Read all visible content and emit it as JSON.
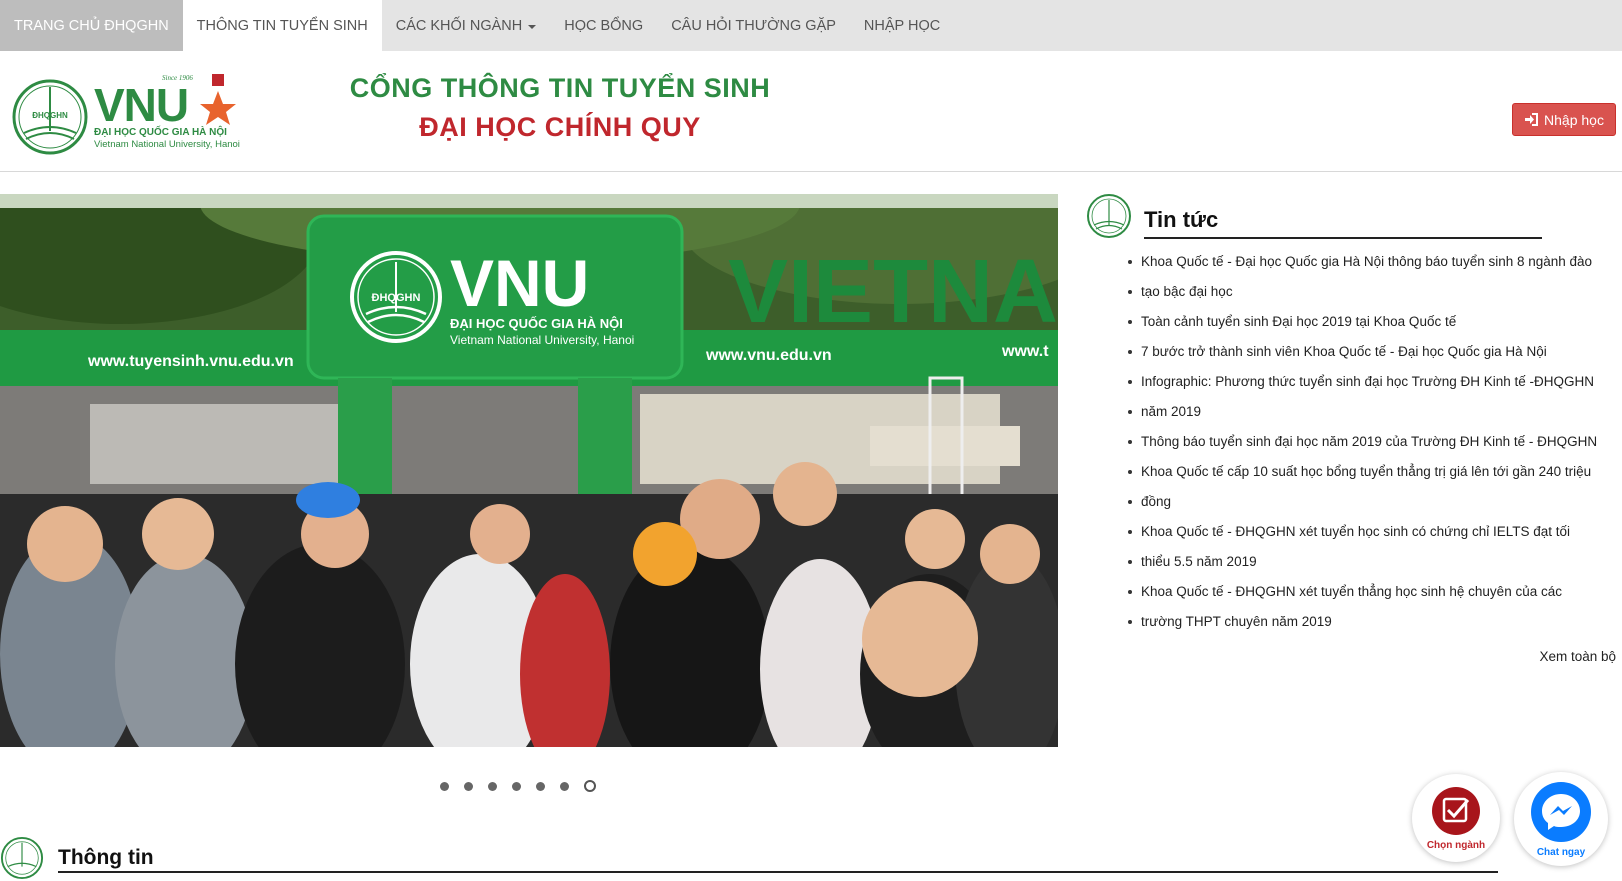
{
  "nav": {
    "home": "TRANG CHỦ ĐHQGHN",
    "admission_info": "THÔNG TIN TUYỂN SINH",
    "fields": "CÁC KHỐI NGÀNH",
    "scholarship": "HỌC BỔNG",
    "faq": "CÂU HỎI THƯỜNG GẶP",
    "enroll": "NHẬP HỌC"
  },
  "header": {
    "logo": {
      "since": "Since 1906",
      "brand": "VNU",
      "seal_text": "ĐHQGHN",
      "name_vi": "ĐẠI HỌC QUỐC GIA HÀ NỘI",
      "name_en": "Vietnam National University, Hanoi"
    },
    "title_line1": "CỔNG THÔNG TIN TUYỂN SINH",
    "title_line2": "ĐẠI HỌC CHÍNH QUY",
    "login_button": "Nhập học"
  },
  "carousel": {
    "sign_brand": "VNU",
    "sign_seal": "ĐHQGHN",
    "sign_name_vi": "ĐẠI HỌC QUỐC GIA HÀ NỘI",
    "sign_name_en": "Vietnam National University, Hanoi",
    "url_left": "www.tuyensinh.vnu.edu.vn",
    "url_center": "www.vnu.edu.vn",
    "url_right": "www.t",
    "backdrop_word": "VIETNAM",
    "dot_count": 7,
    "active_dot": 7
  },
  "news": {
    "title": "Tin tức",
    "items": [
      "Khoa Quốc tế - Đại học Quốc gia Hà Nội thông báo tuyển sinh 8 ngành đào",
      "tạo bậc đại học",
      "Toàn cảnh tuyển sinh Đại học 2019 tại Khoa Quốc tế",
      "7 bước trở thành sinh viên Khoa Quốc tế - Đại học Quốc gia Hà Nội",
      "Infographic: Phương thức tuyển sinh đại học Trường ĐH Kinh tế -ĐHQGHN",
      "năm 2019",
      "Thông báo tuyển sinh đại học năm 2019 của Trường ĐH Kinh tế - ĐHQGHN",
      "Khoa Quốc tế cấp 10 suất học bổng tuyển thẳng trị giá lên tới gần 240 triệu",
      "đồng",
      "Khoa Quốc tế - ĐHQGHN xét tuyển học sinh có chứng chỉ IELTS đạt tối",
      "thiểu 5.5 năm 2019",
      "Khoa Quốc tế - ĐHQGHN xét tuyển thẳng học sinh hệ chuyên của các",
      "trường THPT chuyên năm 2019"
    ],
    "see_all": "Xem toàn bộ"
  },
  "info_section": {
    "title": "Thông tin"
  },
  "fab": {
    "choose_major": "Chọn ngành",
    "chat": "Chat ngay"
  },
  "colors": {
    "brand_green": "#2e8b43",
    "brand_red": "#c0272d",
    "button_red": "#d9534f",
    "messenger_blue": "#0a7cff"
  }
}
